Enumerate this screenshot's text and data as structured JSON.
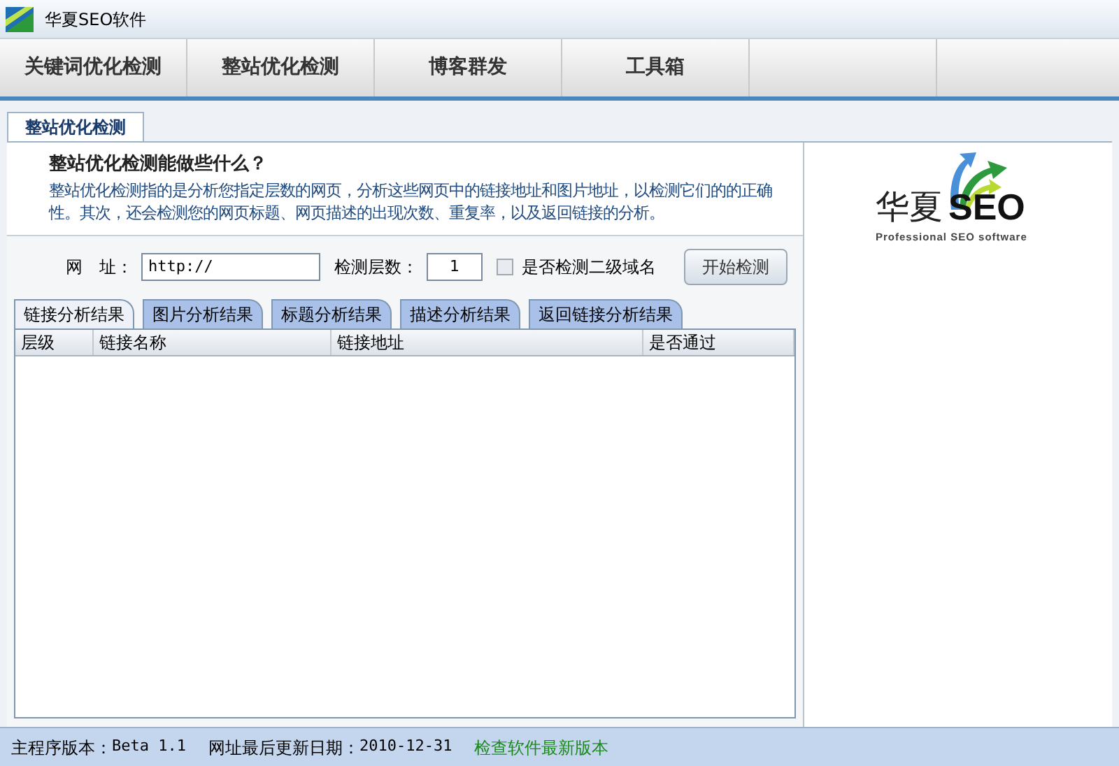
{
  "window": {
    "title": "华夏SEO软件"
  },
  "nav": [
    "关键词优化检测",
    "整站优化检测",
    "博客群发",
    "工具箱"
  ],
  "sub_tabs": [
    {
      "label": "整站优化检测",
      "selected": true
    }
  ],
  "intro": {
    "heading": "整站优化检测能做些什么？",
    "body": "整站优化检测指的是分析您指定层数的网页，分析这些网页中的链接地址和图片地址，以检测它们的的正确性。其次，还会检测您的网页标题、网页描述的出现次数、重复率，以及返回链接的分析。"
  },
  "form": {
    "url_label": "网　址：",
    "url_value": "http://",
    "depth_label": "检测层数：",
    "depth_value": "1",
    "subdomain": {
      "label": "是否检测二级域名",
      "checked": false
    },
    "start_button": "开始检测"
  },
  "result_tabs": [
    {
      "label": "链接分析结果",
      "selected": true
    },
    {
      "label": "图片分析结果",
      "selected": false
    },
    {
      "label": "标题分析结果",
      "selected": false
    },
    {
      "label": "描述分析结果",
      "selected": false
    },
    {
      "label": "返回链接分析结果",
      "selected": false
    }
  ],
  "table": {
    "columns": [
      "层级",
      "链接名称",
      "链接地址",
      "是否通过"
    ]
  },
  "logo": {
    "name": "华夏",
    "mark": "SEO",
    "tagline": "Professional SEO software"
  },
  "status_bar": {
    "version_label": "主程序版本：",
    "version": "Beta 1.1",
    "date_label": "网址最后更新日期：",
    "date": "2010-12-31",
    "update_link": "检查软件最新版本"
  }
}
